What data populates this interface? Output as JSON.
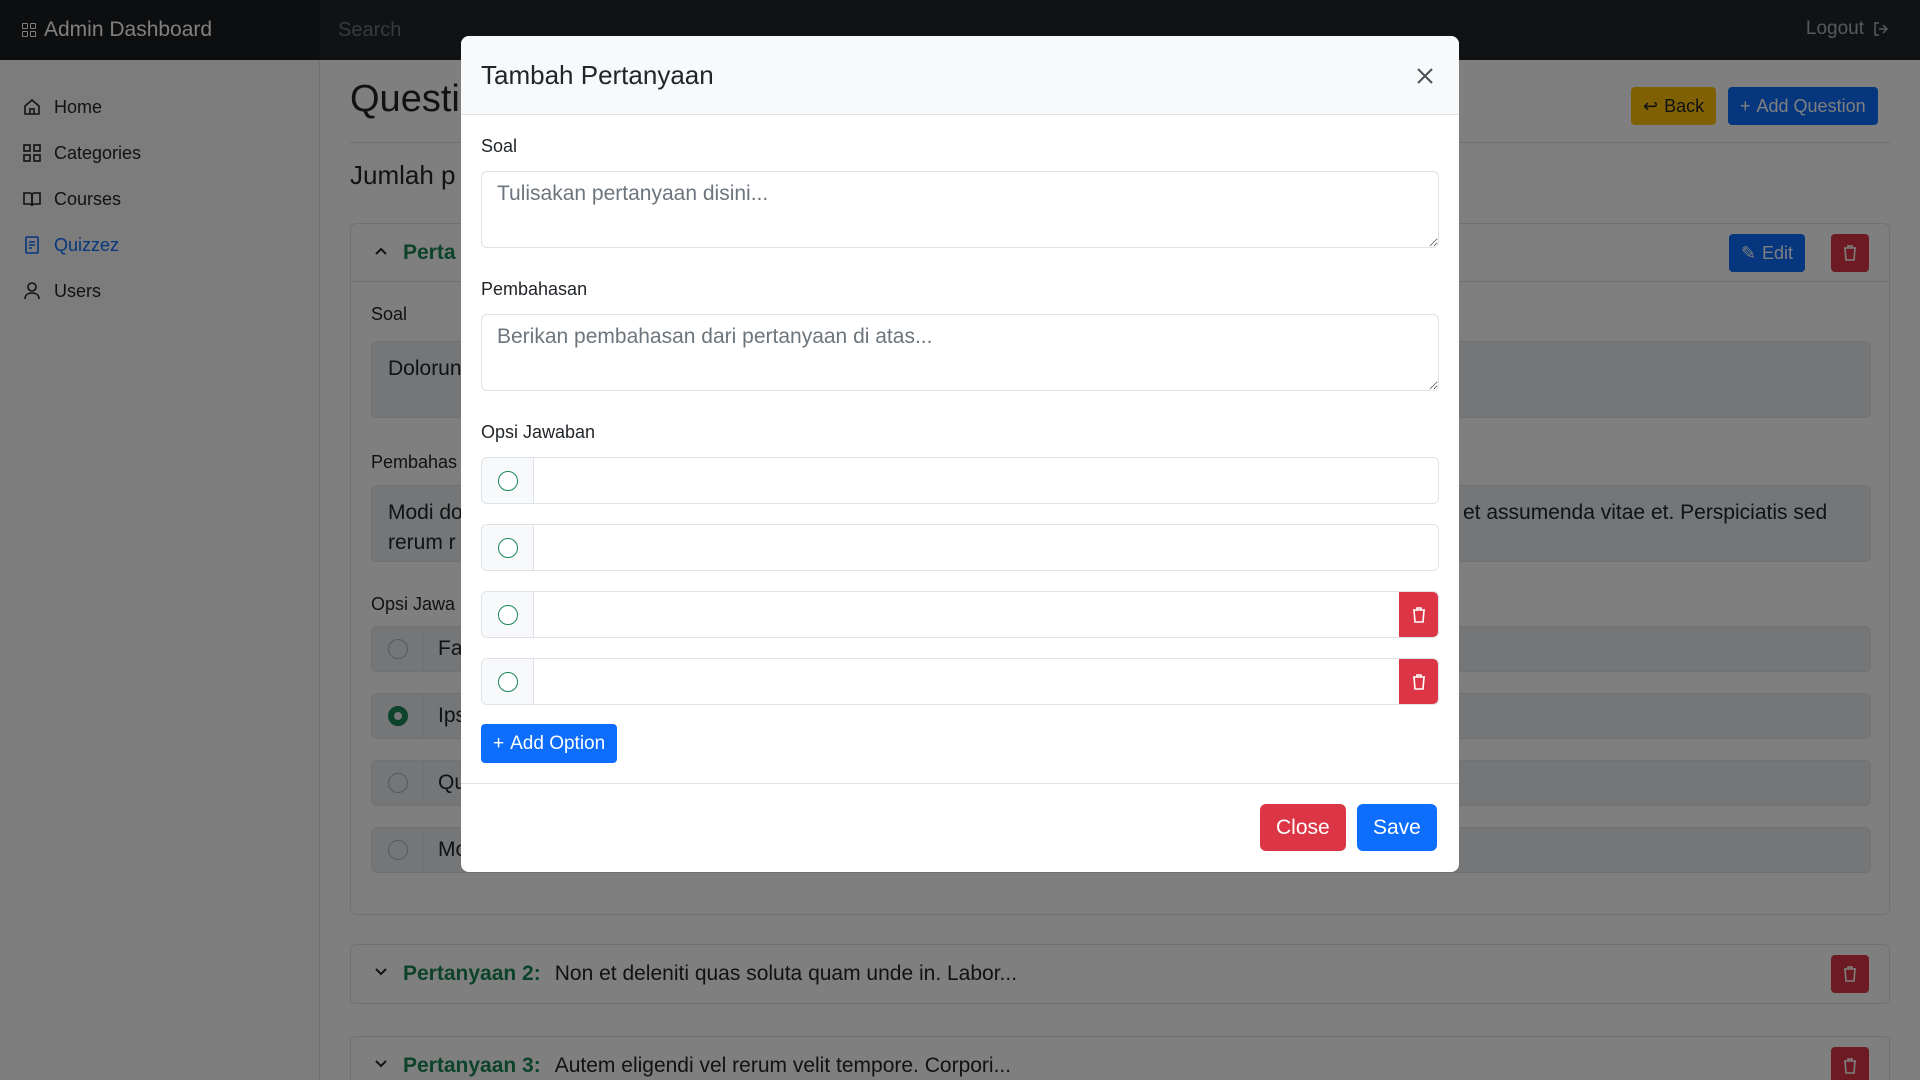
{
  "navbar": {
    "brand": "Admin Dashboard",
    "search_placeholder": "Search",
    "logout": "Logout"
  },
  "sidebar": {
    "items": [
      {
        "label": "Home",
        "icon": "home-icon"
      },
      {
        "label": "Categories",
        "icon": "grid-icon"
      },
      {
        "label": "Courses",
        "icon": "book-icon"
      },
      {
        "label": "Quizzez",
        "icon": "quiz-icon",
        "active": true
      },
      {
        "label": "Users",
        "icon": "user-icon"
      }
    ]
  },
  "main": {
    "title": "Questi",
    "back_label": "Back",
    "add_question_label": "Add Question",
    "count_label": "Jumlah p",
    "question1": {
      "header_label": "Perta",
      "edit_label": "Edit",
      "soal_label": "Soal",
      "soal_text": "Dolorun",
      "pembahasan_label": "Pembahas",
      "pembahasan_text_left": "Modi do",
      "pembahasan_text_left2": "rerum r",
      "pembahasan_text_right": "et assumenda vitae et. Perspiciatis sed",
      "opsi_label": "Opsi Jawa",
      "options": [
        "Fa",
        "Ips",
        "Qu",
        "Mo"
      ]
    },
    "question2": {
      "label": "Pertanyaan 2:",
      "text": "Non et deleniti quas soluta quam unde in. Labor..."
    },
    "question3": {
      "label": "Pertanyaan 3:",
      "text": "Autem eligendi vel rerum velit tempore. Corpori..."
    }
  },
  "modal": {
    "title": "Tambah Pertanyaan",
    "soal_label": "Soal",
    "soal_placeholder": "Tulisakan pertanyaan disini...",
    "pembahasan_label": "Pembahasan",
    "pembahasan_placeholder": "Berikan pembahasan dari pertanyaan di atas...",
    "opsi_label": "Opsi Jawaban",
    "add_option_label": "Add Option",
    "close_label": "Close",
    "save_label": "Save"
  },
  "colors": {
    "primary": "#0d6efd",
    "danger": "#dc3545",
    "warning": "#ffc107",
    "success": "#198754",
    "navbar": "#212529"
  }
}
